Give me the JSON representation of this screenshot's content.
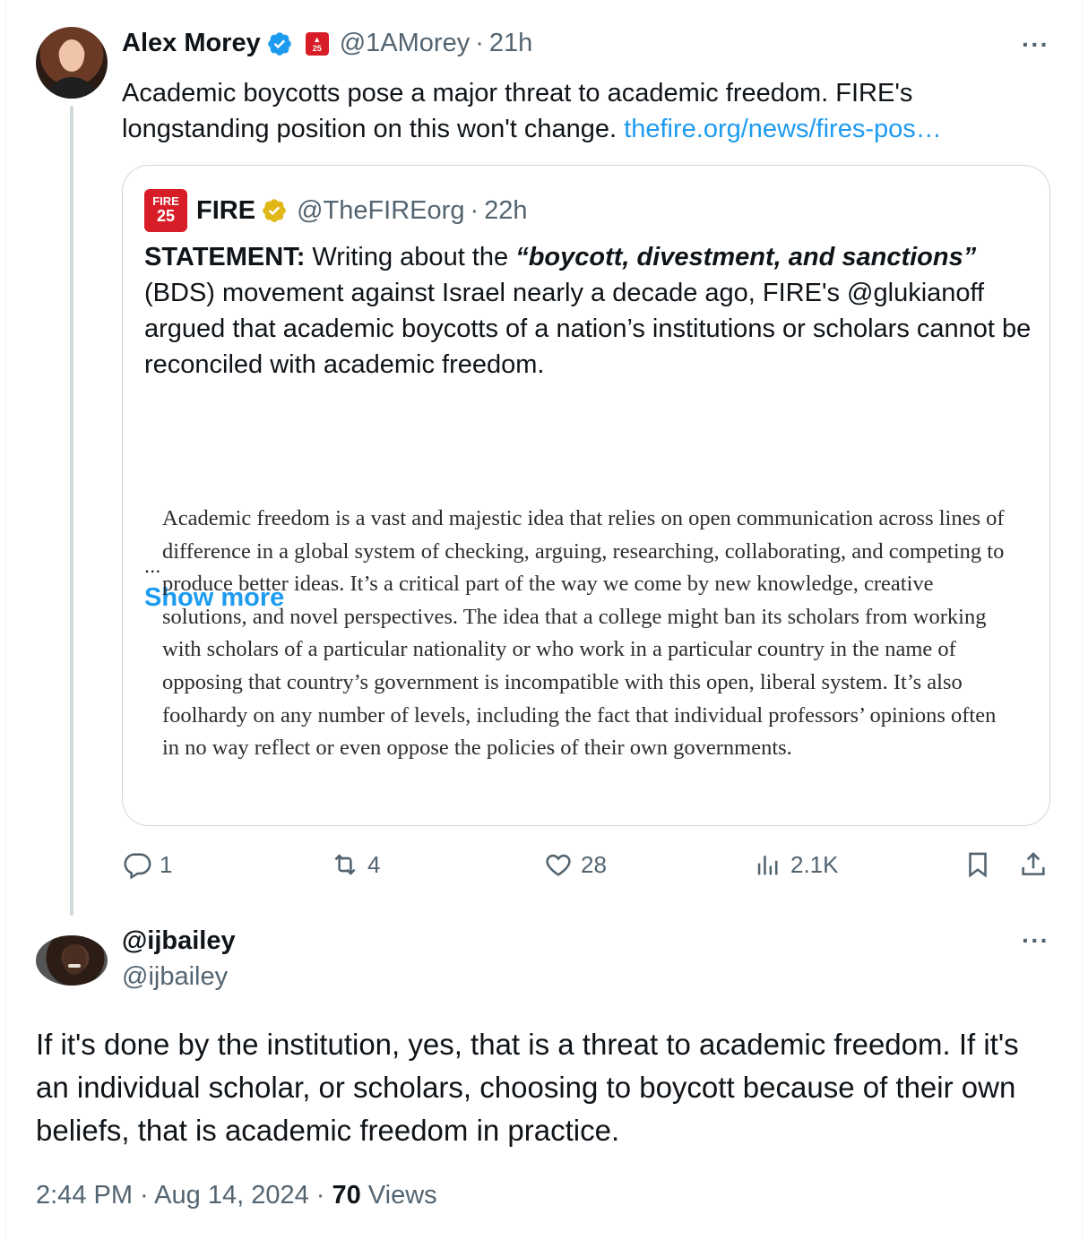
{
  "tweet": {
    "author_name": "Alex Morey",
    "handle": "@1AMorey",
    "time": "21h",
    "text": "Academic boycotts pose a major threat to academic freedom. FIRE's longstanding position on this won't change.",
    "link": "thefire.org/news/fires-pos…",
    "actions": {
      "replies": "1",
      "reposts": "4",
      "likes": "28",
      "views": "2.1K"
    }
  },
  "quote": {
    "logo_text_top": "FIRE",
    "logo_text_bottom": "25",
    "author_name": "FIRE",
    "handle": "@TheFIREorg",
    "time": "22h",
    "statement_label": "STATEMENT:",
    "text_part1": " Writing about the ",
    "text_emphasis": "“boycott, divestment, and sanctions”",
    "text_part2": " (BDS) movement against Israel nearly a decade ago, FIRE's @glukianoff argued that academic boycotts of a nation’s institutions or scholars cannot be reconciled with academic freedom.",
    "ellipsis": "...",
    "show_more": "Show more",
    "image_text": "Academic freedom is a vast and majestic idea that relies on open communication across lines of difference in a global system of checking, arguing, researching, collaborating, and competing to produce better ideas. It’s a critical part of the way we come by new knowledge, creative solutions, and novel perspectives. The idea that a college might ban its scholars from working with scholars of a particular nationality or who work in a particular country in the name of opposing that country’s government is incompatible with this open, liberal system. It’s also foolhardy on any number of levels, including the fact that individual professors’ opinions often in no way reflect or even oppose the policies of their own governments."
  },
  "reply": {
    "author_name": "@ijbailey",
    "handle": "@ijbailey",
    "text": "If it's done by the institution, yes, that is a threat to academic freedom. If it's an individual scholar, or scholars, choosing to boycott because of their own beliefs, that is academic freedom in practice.",
    "timestamp": "2:44 PM · Aug 14, 2024 · ",
    "views_count": "70",
    "views_label": " Views"
  },
  "misc": {
    "dot": "·",
    "more": "···"
  },
  "icons": [
    "verified-badge-icon",
    "fire-badge-icon",
    "gold-verified-icon",
    "more-icon",
    "reply-icon",
    "repost-icon",
    "like-icon",
    "views-icon",
    "bookmark-icon",
    "share-icon"
  ],
  "colors": {
    "link": "#1d9bf0",
    "muted": "#536471",
    "fire_red": "#d71e28",
    "verified_blue": "#1d9bf0",
    "verified_gold": "#e2b719"
  }
}
